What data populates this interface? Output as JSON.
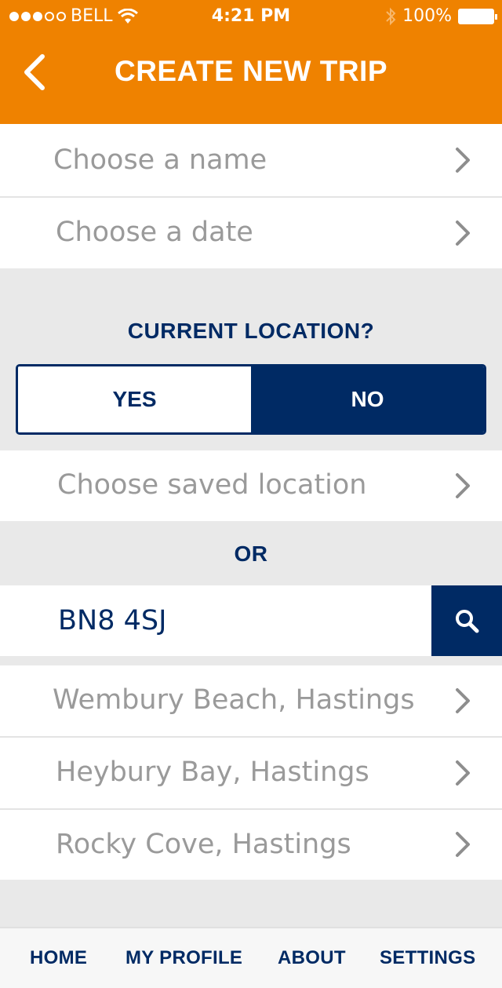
{
  "status_bar": {
    "carrier": "BELL",
    "time": "4:21 PM",
    "battery": "100%",
    "signal_bars_filled": 3,
    "signal_bars_total": 5
  },
  "header": {
    "title": "CREATE NEW TRIP",
    "back_icon": "chevron-left-icon"
  },
  "form": {
    "name_label": "Choose a name",
    "date_label": "Choose a date",
    "current_location_prompt": "CURRENT LOCATION?",
    "toggle": {
      "yes": "YES",
      "no": "NO",
      "selected": "NO"
    },
    "saved_location_label": "Choose  saved location",
    "or_label": "OR",
    "search_value": "BN8 4SJ"
  },
  "results": [
    {
      "label": "Wembury Beach, Hastings"
    },
    {
      "label": "Heybury Bay, Hastings"
    },
    {
      "label": "Rocky Cove, Hastings"
    }
  ],
  "tabbar": {
    "home": "HOME",
    "profile": "MY PROFILE",
    "about": "ABOUT",
    "settings": "SETTINGS"
  },
  "colors": {
    "brand_orange": "#ef8200",
    "navy": "#002a64",
    "muted_text": "#9a9a9a"
  }
}
